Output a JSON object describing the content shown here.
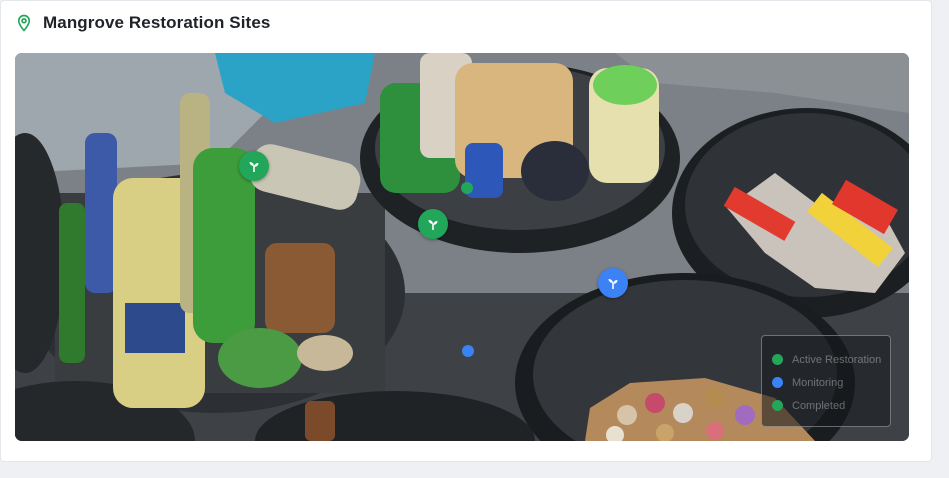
{
  "card": {
    "title": "Mangrove Restoration Sites",
    "title_icon": "map-pin-icon"
  },
  "colors": {
    "accent_green": "#22a65a",
    "accent_blue": "#3b82f6",
    "title_text": "#1f2328"
  },
  "map": {
    "markers": [
      {
        "type": "sprout-marker",
        "color": "#22a65a"
      },
      {
        "type": "sprout-marker",
        "color": "#22a65a"
      },
      {
        "type": "sprout-marker",
        "color": "#3b82f6"
      },
      {
        "type": "small-dot",
        "color": "#22a65a"
      },
      {
        "type": "small-dot",
        "color": "#3b82f6"
      }
    ],
    "legend": {
      "items": [
        {
          "label": "Active Restoration",
          "color": "#22a65a"
        },
        {
          "label": "Monitoring",
          "color": "#3b82f6"
        },
        {
          "label": "Completed",
          "color": "#22a65a"
        }
      ]
    }
  }
}
